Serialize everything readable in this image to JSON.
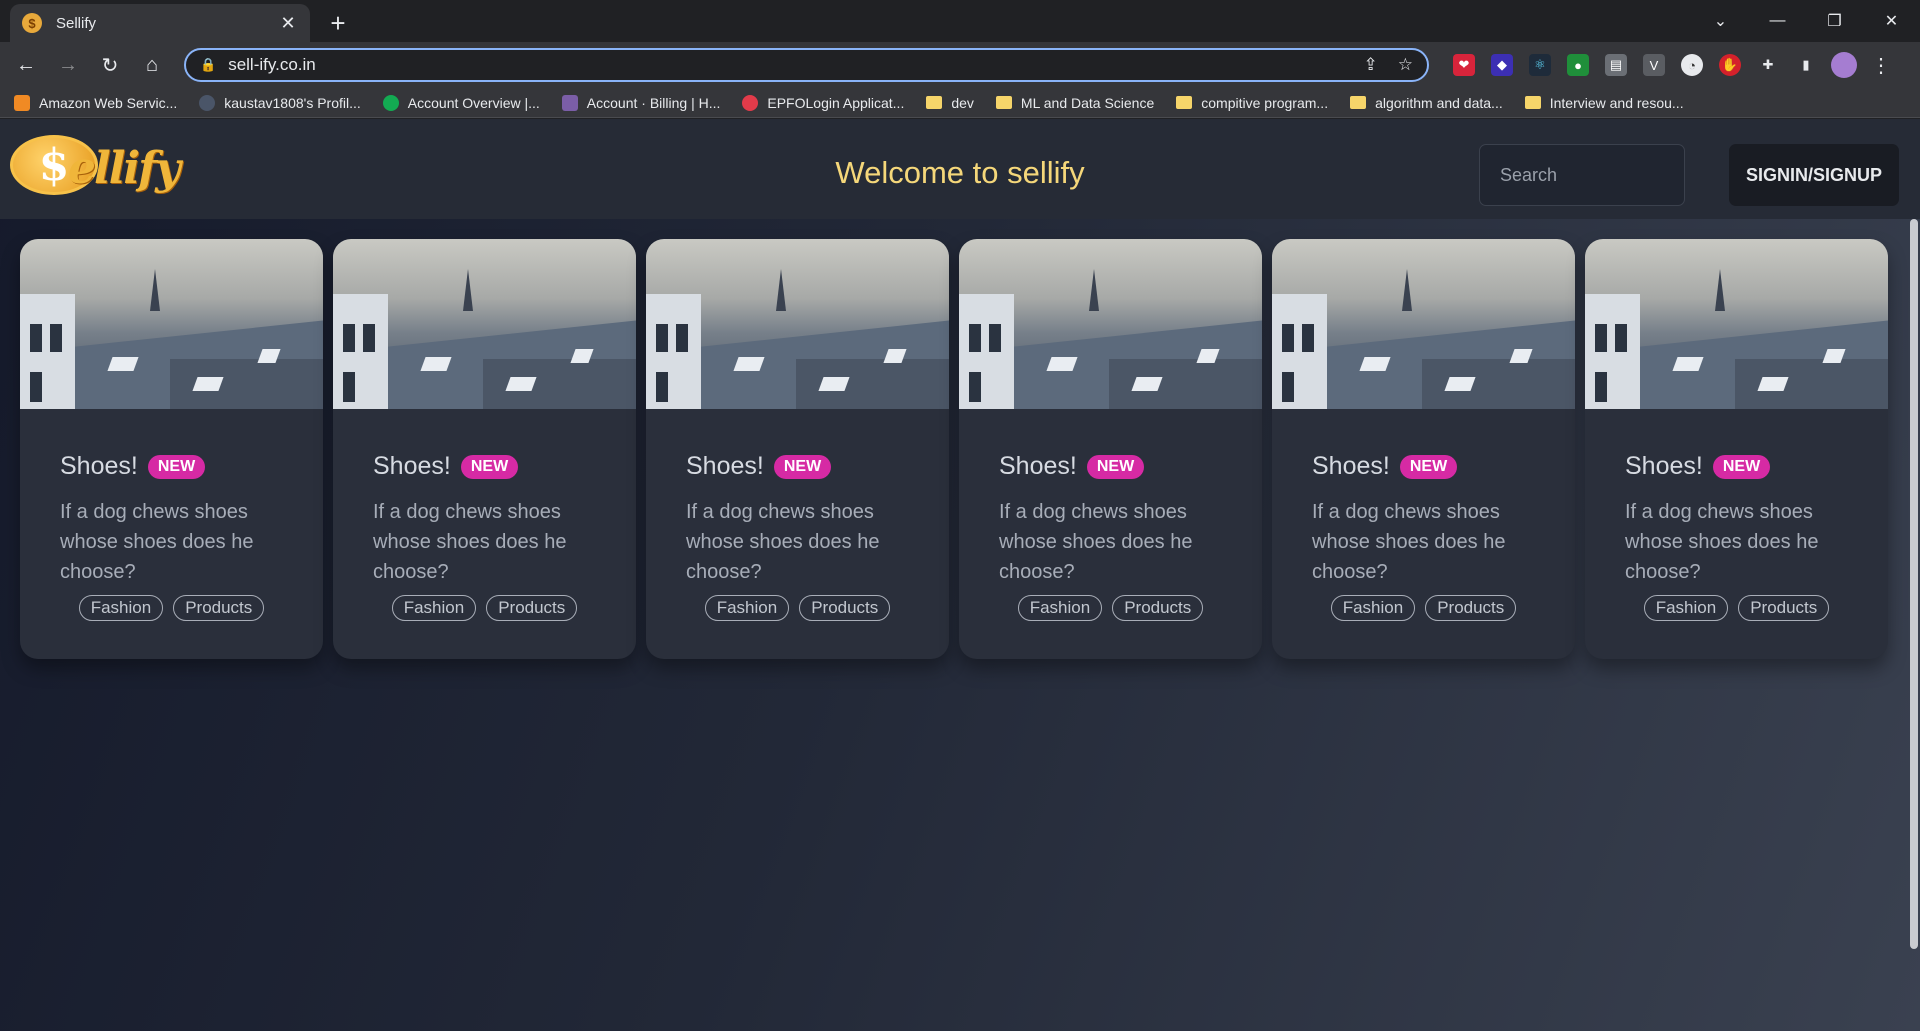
{
  "browser": {
    "tab_title": "Sellify",
    "tab_favicon": "$",
    "tab_close": "✕",
    "new_tab": "+",
    "url": "sell-ify.co.in",
    "window_controls": [
      "⌄",
      "—",
      "❐",
      "✕"
    ]
  },
  "bookmarks": [
    {
      "label": "Amazon Web Servic...",
      "icon": "aws-icon",
      "color": "#f08a24"
    },
    {
      "label": "kaustav1808's Profil...",
      "icon": "profile-icon",
      "color": "#4a5568"
    },
    {
      "label": "Account Overview |...",
      "icon": "mongodb-icon",
      "color": "#13aa52"
    },
    {
      "label": "Account · Billing | H...",
      "icon": "heroku-icon",
      "color": "#7b5ea7"
    },
    {
      "label": "EPFOLogin Applicat...",
      "icon": "epfo-icon",
      "color": "#e23b4a"
    },
    {
      "label": "dev",
      "icon": "folder-icon",
      "color": "#f6d56a"
    },
    {
      "label": "ML and Data Science",
      "icon": "folder-icon",
      "color": "#f6d56a"
    },
    {
      "label": "compitive program...",
      "icon": "folder-icon",
      "color": "#f6d56a"
    },
    {
      "label": "algorithm and data...",
      "icon": "folder-icon",
      "color": "#f6d56a"
    },
    {
      "label": "Interview and resou...",
      "icon": "folder-icon",
      "color": "#f6d56a"
    }
  ],
  "site": {
    "logo_text": "ellify",
    "title": "Welcome to sellify",
    "search_placeholder": "Search",
    "signin_label": "SIGNIN/SIGNUP"
  },
  "cards": [
    {
      "title": "Shoes!",
      "badge": "NEW",
      "description": "If a dog chews shoes whose shoes does he choose?",
      "tags": [
        "Fashion",
        "Products"
      ]
    },
    {
      "title": "Shoes!",
      "badge": "NEW",
      "description": "If a dog chews shoes whose shoes does he choose?",
      "tags": [
        "Fashion",
        "Products"
      ]
    },
    {
      "title": "Shoes!",
      "badge": "NEW",
      "description": "If a dog chews shoes whose shoes does he choose?",
      "tags": [
        "Fashion",
        "Products"
      ]
    },
    {
      "title": "Shoes!",
      "badge": "NEW",
      "description": "If a dog chews shoes whose shoes does he choose?",
      "tags": [
        "Fashion",
        "Products"
      ]
    },
    {
      "title": "Shoes!",
      "badge": "NEW",
      "description": "If a dog chews shoes whose shoes does he choose?",
      "tags": [
        "Fashion",
        "Products"
      ]
    },
    {
      "title": "Shoes!",
      "badge": "NEW",
      "description": "If a dog chews shoes whose shoes does he choose?",
      "tags": [
        "Fashion",
        "Products"
      ]
    }
  ],
  "colors": {
    "accent_title": "#f5d77a",
    "badge": "#d62aa4",
    "card_bg": "#2a2f3b",
    "navbar_bg": "#262b36"
  }
}
